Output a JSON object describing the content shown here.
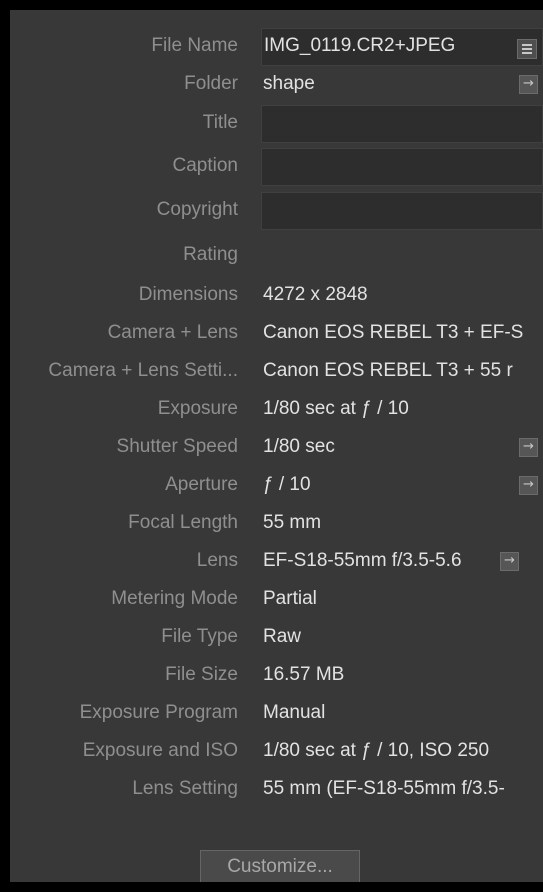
{
  "metadata": {
    "file_name": {
      "label": "File Name",
      "value": "IMG_0119.CR2+JPEG"
    },
    "folder": {
      "label": "Folder",
      "value": "shape"
    },
    "title": {
      "label": "Title",
      "value": ""
    },
    "caption": {
      "label": "Caption",
      "value": ""
    },
    "copyright": {
      "label": "Copyright",
      "value": ""
    },
    "rating": {
      "label": "Rating",
      "value": ""
    },
    "dimensions": {
      "label": "Dimensions",
      "value": "4272 x 2848"
    },
    "camera_lens": {
      "label": "Camera + Lens",
      "value": "Canon EOS REBEL T3 + EF-S"
    },
    "camera_lens_settings": {
      "label": "Camera + Lens Setti...",
      "value": "Canon EOS REBEL T3 + 55 r"
    },
    "exposure": {
      "label": "Exposure",
      "value": "1/80 sec at ƒ / 10"
    },
    "shutter_speed": {
      "label": "Shutter Speed",
      "value": "1/80 sec"
    },
    "aperture": {
      "label": "Aperture",
      "value": "ƒ / 10"
    },
    "focal_length": {
      "label": "Focal Length",
      "value": "55 mm"
    },
    "lens": {
      "label": "Lens",
      "value": "EF-S18-55mm f/3.5-5.6"
    },
    "metering_mode": {
      "label": "Metering Mode",
      "value": "Partial"
    },
    "file_type": {
      "label": "File Type",
      "value": "Raw"
    },
    "file_size": {
      "label": "File Size",
      "value": "16.57 MB"
    },
    "exposure_program": {
      "label": "Exposure Program",
      "value": "Manual"
    },
    "exposure_iso": {
      "label": "Exposure and ISO",
      "value": "1/80 sec at ƒ / 10, ISO 250"
    },
    "lens_setting": {
      "label": "Lens Setting",
      "value": "55 mm (EF-S18-55mm f/3.5-"
    }
  },
  "icons": {
    "go_arrow": "→",
    "list_icon": "list-icon"
  },
  "footer": {
    "customize_label": "Customize..."
  },
  "colors": {
    "panel_bg": "#383838",
    "label_text": "#8f8f8f",
    "value_text": "#e2e2e2",
    "field_bg": "#2d2d2d"
  }
}
